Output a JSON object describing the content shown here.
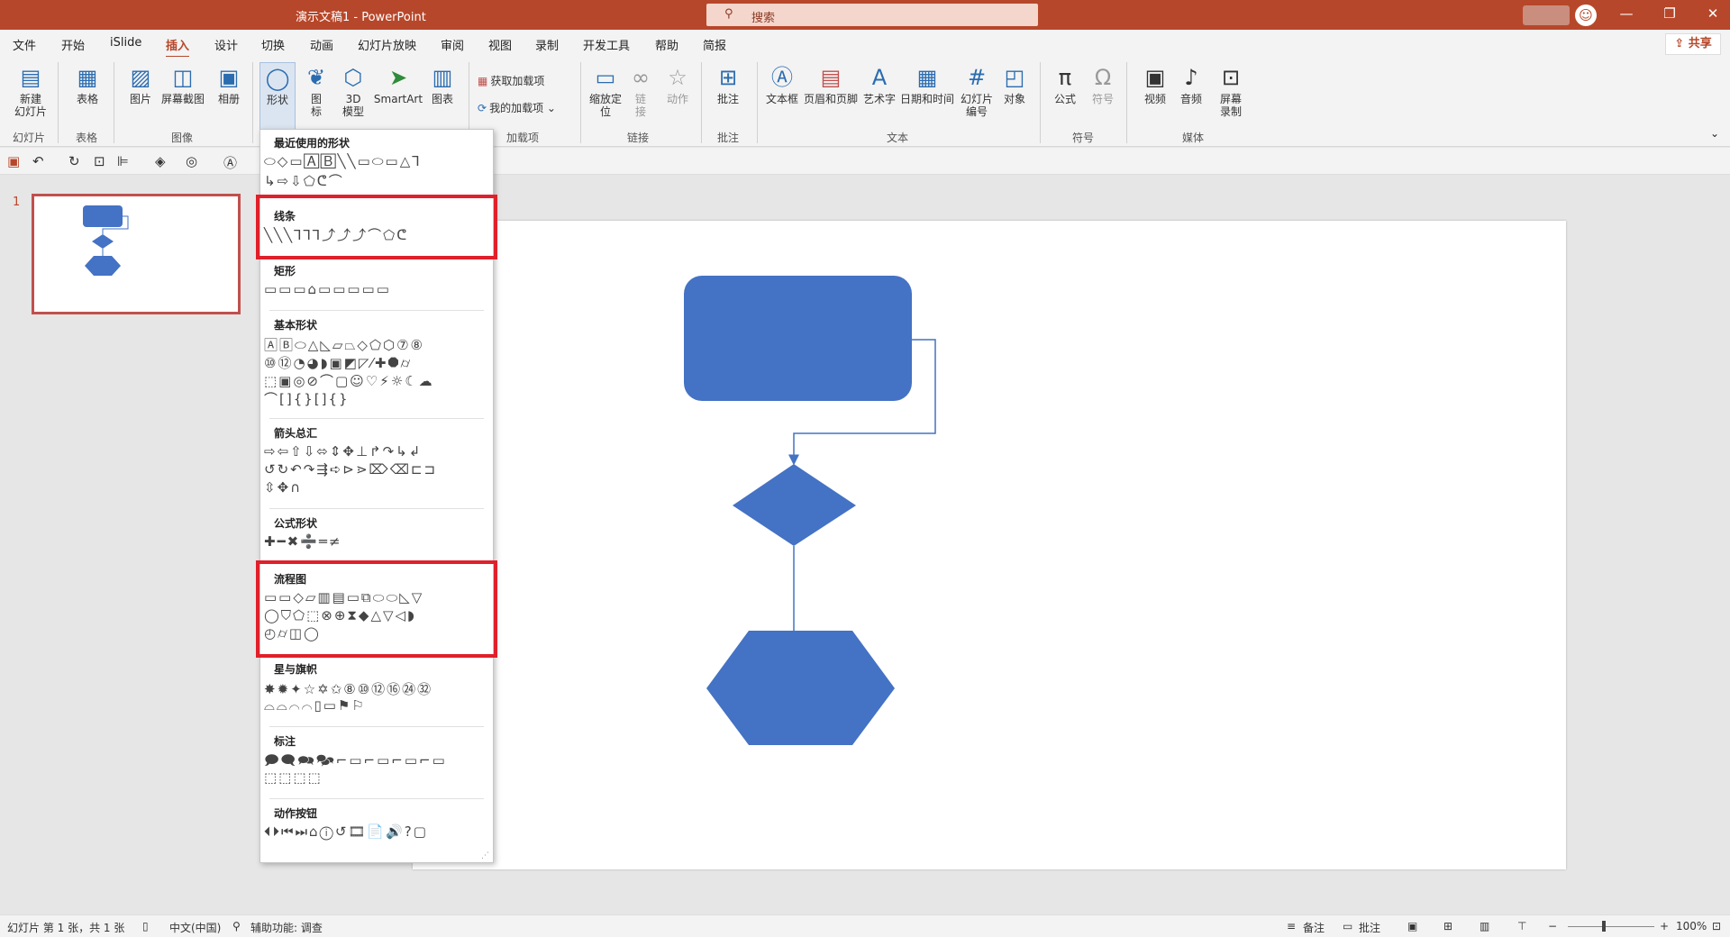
{
  "titlebar": {
    "doc_title": "演示文稿1  -  PowerPoint",
    "search_placeholder": "搜索"
  },
  "menu": [
    "文件",
    "开始",
    "iSlide",
    "插入",
    "设计",
    "切换",
    "动画",
    "幻灯片放映",
    "审阅",
    "视图",
    "录制",
    "开发工具",
    "帮助",
    "简报"
  ],
  "menu_active": "插入",
  "share_label": "共享",
  "ribbon": {
    "new_slide": "新建\n幻灯片",
    "table": "表格",
    "picture": "图片",
    "screenshot": "屏幕截图",
    "album": "相册",
    "shapes": "形状",
    "icons": "图\n标",
    "model3d": "3D\n模型",
    "smartart": "SmartArt",
    "chart": "图表",
    "get_addins": "获取加载项",
    "my_addins": "我的加载项",
    "zoom": "缩放定\n位",
    "link": "链\n接",
    "action": "动作",
    "comment": "批注",
    "textbox": "文本框",
    "header_footer": "页眉和页脚",
    "wordart": "艺术字",
    "datetime": "日期和时间",
    "slide_number": "幻灯片\n编号",
    "object": "对象",
    "equation": "公式",
    "symbol": "符号",
    "video": "视频",
    "audio": "音频",
    "screen_rec": "屏幕\n录制",
    "groups": {
      "slides": "幻灯片",
      "tables": "表格",
      "images": "图像",
      "addins": "加载项",
      "links": "链接",
      "comments": "批注",
      "text": "文本",
      "symbols": "符号",
      "media": "媒体"
    }
  },
  "thumbnail_number": "1",
  "shapes_menu": {
    "recent": "最近使用的形状",
    "lines": "线条",
    "rectangles": "矩形",
    "basic": "基本形状",
    "arrows": "箭头总汇",
    "equation": "公式形状",
    "flowchart": "流程图",
    "stars": "星与旗帜",
    "callouts": "标注",
    "action_buttons": "动作按钮"
  },
  "statusbar": {
    "slide_info": "幻灯片 第 1 张，共 1 张",
    "language": "中文(中国)",
    "accessibility": "辅助功能: 调查",
    "notes": "备注",
    "comments": "批注",
    "zoom": "100%"
  },
  "colors": {
    "accent": "#b7472a",
    "shape_fill": "#4472c4",
    "highlight": "#e0202a"
  }
}
